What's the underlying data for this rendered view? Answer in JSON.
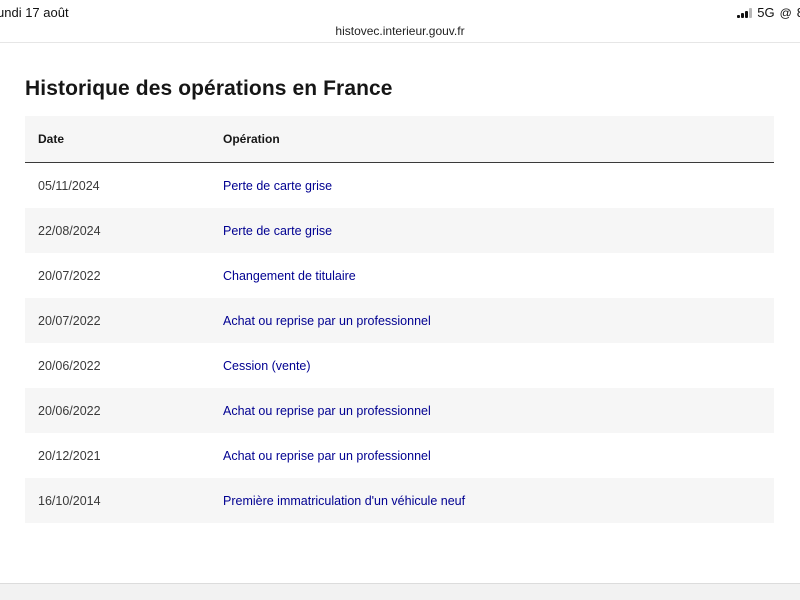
{
  "status_bar": {
    "date": "undi 17 août",
    "network": "5G",
    "battery": "8"
  },
  "browser": {
    "url": "histovec.interieur.gouv.fr"
  },
  "page": {
    "title": "Historique des opérations en France",
    "table": {
      "headers": [
        "Date",
        "Opération"
      ],
      "rows": [
        {
          "date": "05/11/2024",
          "operation": "Perte de carte grise"
        },
        {
          "date": "22/08/2024",
          "operation": "Perte de carte grise"
        },
        {
          "date": "20/07/2022",
          "operation": "Changement de titulaire"
        },
        {
          "date": "20/07/2022",
          "operation": "Achat ou reprise par un professionnel"
        },
        {
          "date": "20/06/2022",
          "operation": "Cession (vente)"
        },
        {
          "date": "20/06/2022",
          "operation": "Achat ou reprise par un professionnel"
        },
        {
          "date": "20/12/2021",
          "operation": "Achat ou reprise par un professionnel"
        },
        {
          "date": "16/10/2014",
          "operation": "Première immatriculation d'un véhicule neuf"
        }
      ]
    }
  }
}
